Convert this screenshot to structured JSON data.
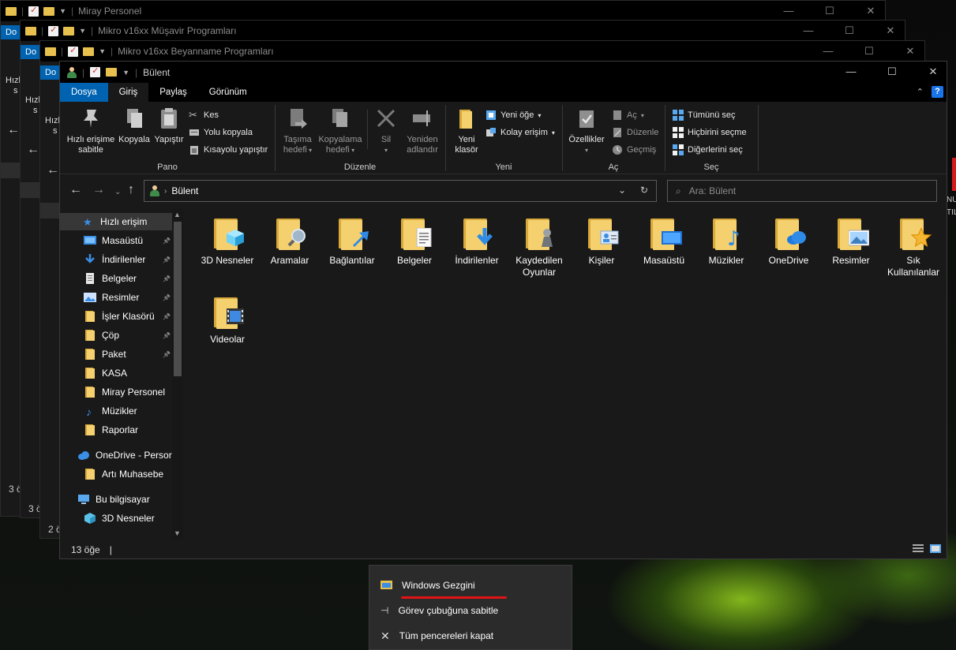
{
  "background_windows": [
    {
      "title": "Miray Personel",
      "tab": "Do",
      "side_text_1": "Hızlı",
      "side_text_2": "s",
      "status": "3 ö"
    },
    {
      "title": "Mikro v16xx Müşavir Programları",
      "tab": "Do",
      "side_text_1": "Hızl",
      "side_text_2": "s",
      "status": "3 ö"
    },
    {
      "title": "Mikro v16xx Beyanname Programları",
      "tab": "Do",
      "side_text_1": "Hızl",
      "side_text_2": "s",
      "status": "2 ö"
    }
  ],
  "background_text": {
    "line1": "NU",
    "line2": "TIL"
  },
  "window": {
    "title": "Bülent",
    "controls": {
      "minimize": "—",
      "maximize": "☐",
      "close": "✕"
    }
  },
  "ribbon_tabs": [
    {
      "label": "Dosya"
    },
    {
      "label": "Giriş"
    },
    {
      "label": "Paylaş"
    },
    {
      "label": "Görünüm"
    }
  ],
  "ribbon": {
    "groups": {
      "pano": "Pano",
      "duzenle": "Düzenle",
      "yeni": "Yeni",
      "ac": "Aç",
      "sec": "Seç"
    },
    "pin_quick": "Hızlı erişime sabitle",
    "copy": "Kopyala",
    "paste": "Yapıştır",
    "cut": "Kes",
    "copy_path": "Yolu kopyala",
    "paste_shortcut": "Kısayolu yapıştır",
    "move_to": "Taşıma hedefi",
    "copy_to": "Kopyalama hedefi",
    "delete": "Sil",
    "rename": "Yeniden adlandır",
    "new_folder": "Yeni klasör",
    "new_item": "Yeni öğe",
    "easy_access": "Kolay erişim",
    "properties": "Özellikler",
    "open": "Aç",
    "edit": "Düzenle",
    "history": "Geçmiş",
    "select_all": "Tümünü seç",
    "select_none": "Hiçbirini seçme",
    "invert_select": "Diğerlerini seç"
  },
  "address": {
    "path": "Bülent",
    "search_placeholder": "Ara: Bülent"
  },
  "nav_items": [
    {
      "label": "Hızlı erişim",
      "icon": "star-icon"
    },
    {
      "label": "Masaüstü",
      "icon": "desktop-icon",
      "pinned": true
    },
    {
      "label": "İndirilenler",
      "icon": "download-icon",
      "pinned": true
    },
    {
      "label": "Belgeler",
      "icon": "document-icon",
      "pinned": true
    },
    {
      "label": "Resimler",
      "icon": "pictures-icon",
      "pinned": true
    },
    {
      "label": "İşler Klasörü",
      "icon": "folder-icon",
      "pinned": true
    },
    {
      "label": "Çöp",
      "icon": "folder-icon",
      "pinned": true
    },
    {
      "label": "Paket",
      "icon": "folder-icon",
      "pinned": true
    },
    {
      "label": "KASA",
      "icon": "folder-icon"
    },
    {
      "label": "Miray Personel",
      "icon": "folder-icon"
    },
    {
      "label": "Müzikler",
      "icon": "music-icon"
    },
    {
      "label": "Raporlar",
      "icon": "folder-icon"
    },
    {
      "label": "OneDrive - Persor",
      "icon": "cloud-icon"
    },
    {
      "label": "Artı Muhasebe",
      "icon": "folder-icon"
    },
    {
      "label": "Bu bilgisayar",
      "icon": "computer-icon"
    },
    {
      "label": "3D Nesneler",
      "icon": "cube-icon"
    }
  ],
  "folders": [
    {
      "name": "3D Nesneler",
      "overlay": "cube"
    },
    {
      "name": "Aramalar",
      "overlay": "magnifier"
    },
    {
      "name": "Bağlantılar",
      "overlay": "arrow"
    },
    {
      "name": "Belgeler",
      "overlay": "document"
    },
    {
      "name": "İndirilenler",
      "overlay": "download"
    },
    {
      "name": "Kaydedilen Oyunlar",
      "overlay": "chess"
    },
    {
      "name": "Kişiler",
      "overlay": "contact"
    },
    {
      "name": "Masaüstü",
      "overlay": "desktop"
    },
    {
      "name": "Müzikler",
      "overlay": "music"
    },
    {
      "name": "OneDrive",
      "overlay": "cloud"
    },
    {
      "name": "Resimler",
      "overlay": "picture"
    },
    {
      "name": "Sık Kullanılanlar",
      "overlay": "star"
    },
    {
      "name": "Videolar",
      "overlay": "film"
    }
  ],
  "status": {
    "item_count": "13 öğe",
    "cursor": "|"
  },
  "jump_list": {
    "app": "Windows Gezgini",
    "pin": "Görev çubuğuna sabitle",
    "close_all": "Tüm pencereleri kapat"
  },
  "colors": {
    "accent": "#0063b1",
    "folder": "#f5d06e",
    "underline": "#e21414"
  }
}
